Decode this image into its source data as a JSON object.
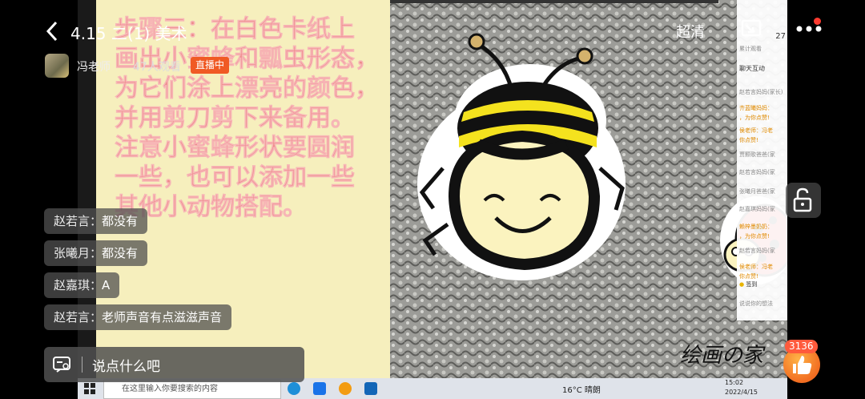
{
  "header": {
    "title": "4.15 二(1) 美术",
    "quality": "超清"
  },
  "teacher": {
    "name": "冯老师",
    "viewers": "47人观看",
    "live_badge": "直播中"
  },
  "slide": {
    "text": "步骤三：在白色卡纸上\n画出小蜜蜂和瓢虫形态，\n为它们涂上漂亮的颜色，\n并用剪刀剪下来备用。\n注意小蜜蜂形状要圆润\n一些，也可以添加一些\n其他小动物搭配。",
    "signature": "绘画の家"
  },
  "chat": [
    {
      "name": "赵若言：",
      "msg": "都没有"
    },
    {
      "name": "张曦月：",
      "msg": "都没有"
    },
    {
      "name": "赵嘉琪：",
      "msg": "A"
    },
    {
      "name": "赵若言：",
      "msg": "老师声音有点滋滋声音"
    }
  ],
  "comment": {
    "placeholder": "说点什么吧"
  },
  "likes": {
    "count": "3136"
  },
  "panel": {
    "count": "27",
    "stat": "累计观看",
    "tab": "聊天互动",
    "rows": [
      "赵若言妈妈(家长)",
      "齐蓝曦妈妈：",
      "，为你点赞!",
      "侯老师：冯老",
      "你点赞!",
      "贾颢歌爸爸(家",
      "赵若言妈妈(家",
      "张曦月爸爸(家",
      "赵嘉琪妈妈(家",
      "赖梓墨奶奶：",
      "，为你点赞!",
      "赵若言妈妈(家",
      "侯老师：冯老",
      "你点赞!"
    ],
    "checkin": "签到",
    "input": "说说你的想法"
  },
  "taskbar": {
    "search_placeholder": "在这里输入你要搜索的内容",
    "weather": "16°C 晴朗",
    "time": "15:02",
    "date": "2022/4/15"
  },
  "colors": {
    "live": "#f05a24",
    "like": "#f26d21",
    "bee_yellow": "#f4e21e",
    "ladybug_red": "#d6262b"
  }
}
